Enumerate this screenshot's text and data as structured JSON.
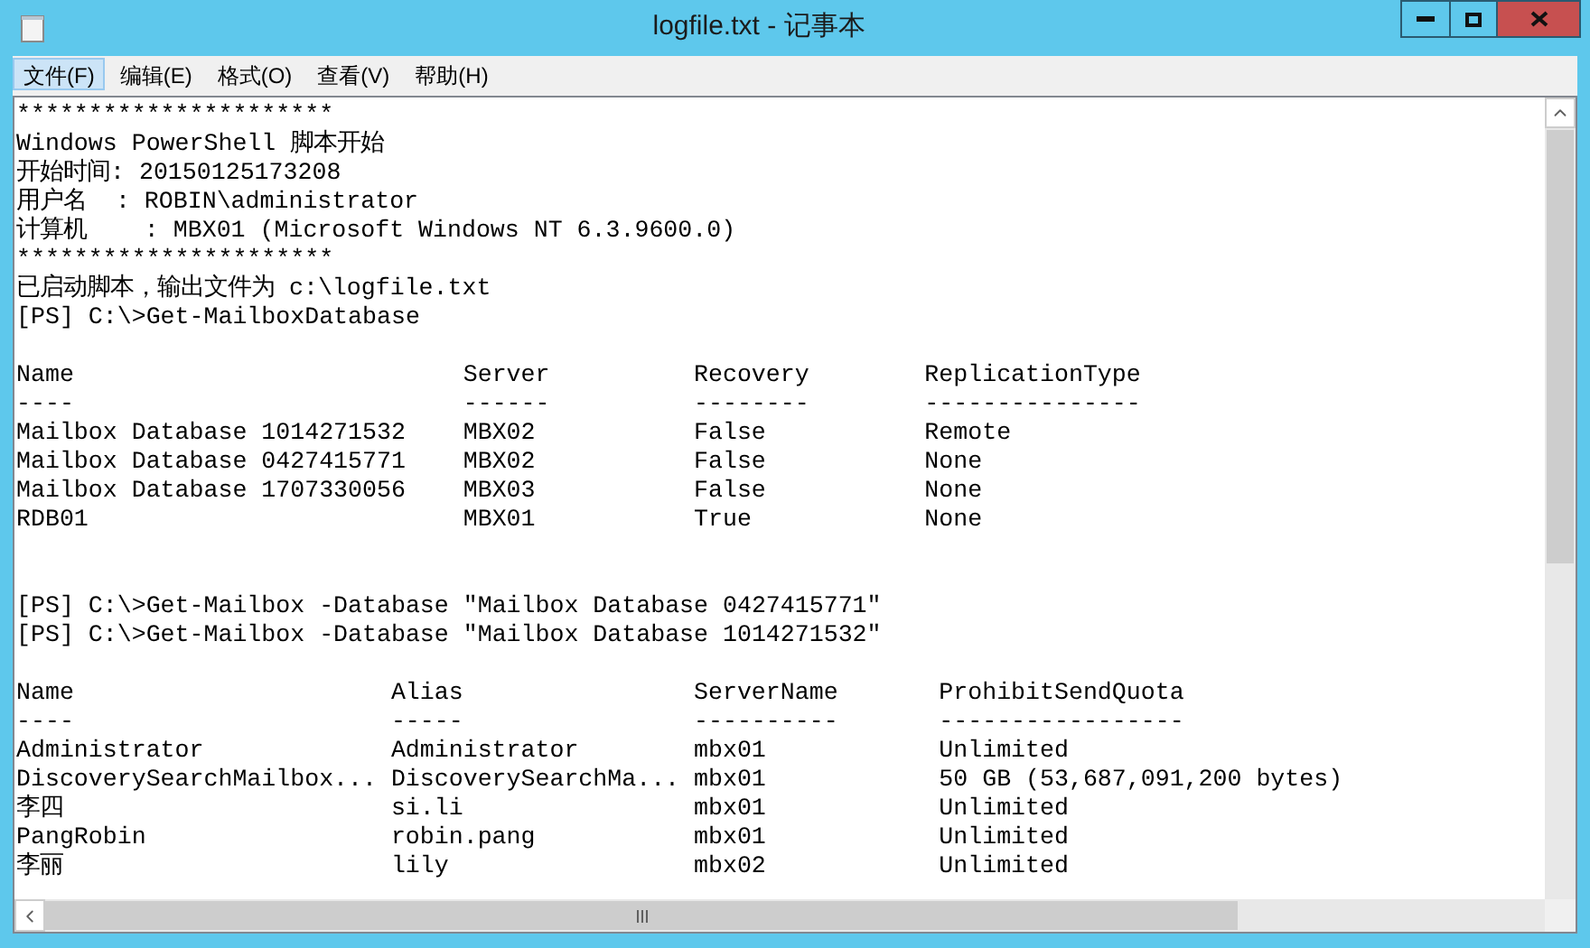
{
  "window": {
    "title": "logfile.txt - 记事本"
  },
  "menu": [
    {
      "label": "文件(F)",
      "selected": true
    },
    {
      "label": "编辑(E)",
      "selected": false
    },
    {
      "label": "格式(O)",
      "selected": false
    },
    {
      "label": "查看(V)",
      "selected": false
    },
    {
      "label": "帮助(H)",
      "selected": false
    }
  ],
  "document": [
    {
      "kind": "text",
      "lines": [
        "**********************",
        "Windows PowerShell 脚本开始",
        "开始时间: 20150125173208",
        "用户名  : ROBIN\\administrator",
        "计算机    : MBX01 (Microsoft Windows NT 6.3.9600.0)",
        "**********************",
        "已启动脚本，输出文件为 c:\\logfile.txt",
        "[PS] C:\\>Get-MailboxDatabase"
      ]
    },
    {
      "kind": "table",
      "columns": [
        {
          "label": "Name",
          "rule": "----"
        },
        {
          "label": "Server",
          "rule": "------"
        },
        {
          "label": "Recovery",
          "rule": "--------"
        },
        {
          "label": "ReplicationType",
          "rule": "---------------"
        }
      ],
      "rows": [
        [
          "Mailbox Database 1014271532",
          "MBX02",
          "False",
          "Remote"
        ],
        [
          "Mailbox Database 0427415771",
          "MBX02",
          "False",
          "None"
        ],
        [
          "Mailbox Database 1707330056",
          "MBX03",
          "False",
          "None"
        ],
        [
          "RDB01",
          "MBX01",
          "True",
          "None"
        ]
      ]
    },
    {
      "kind": "text",
      "lines": [
        "[PS] C:\\>Get-Mailbox -Database ″Mailbox Database 0427415771″",
        "[PS] C:\\>Get-Mailbox -Database ″Mailbox Database 1014271532″"
      ]
    },
    {
      "kind": "table",
      "columns": [
        {
          "label": "Name",
          "rule": "----"
        },
        {
          "label": "Alias",
          "rule": "-----"
        },
        {
          "label": "ServerName",
          "rule": "----------"
        },
        {
          "label": "ProhibitSendQuota",
          "rule": "-----------------"
        }
      ],
      "rows": [
        [
          "Administrator",
          "Administrator",
          "mbx01",
          "Unlimited"
        ],
        [
          "DiscoverySearchMailbox...",
          "DiscoverySearchMa...",
          "mbx01",
          "50 GB (53,687,091,200 bytes)"
        ],
        [
          "李四",
          "si.li",
          "mbx01",
          "Unlimited"
        ],
        [
          "PangRobin",
          "robin.pang",
          "mbx01",
          "Unlimited"
        ],
        [
          "李丽",
          "lily",
          "mbx02",
          "Unlimited"
        ]
      ]
    }
  ]
}
